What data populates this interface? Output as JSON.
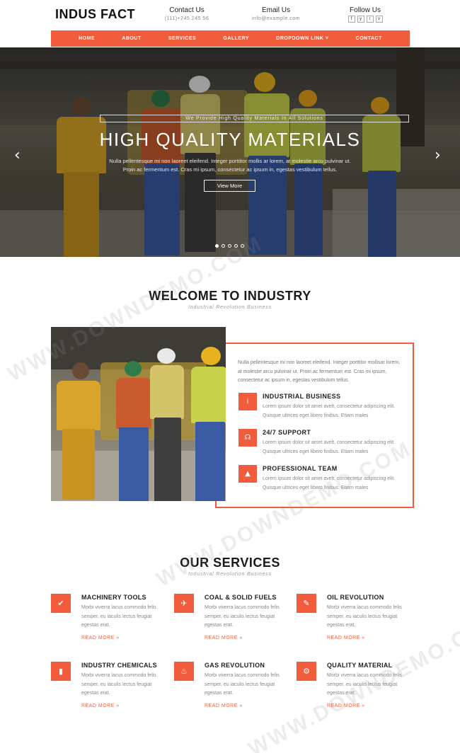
{
  "header": {
    "logo": "INDUS FACT",
    "contact": {
      "heading": "Contact Us",
      "value": "(111)+245 245 56"
    },
    "email": {
      "heading": "Email Us",
      "value": "info@example.com"
    },
    "follow": {
      "heading": "Follow Us",
      "icons": [
        "f",
        "y",
        "r",
        "v"
      ]
    }
  },
  "nav": {
    "items": [
      "HOME",
      "ABOUT",
      "SERVICES",
      "GALLERY",
      "DROPDOWN LINK ˅",
      "CONTACT"
    ]
  },
  "hero": {
    "tagline": "We Provide High Quality Materials In All Solutions",
    "title": "HIGH QUALITY MATERIALS",
    "text": "Nulla pellentesque mi non laoreet eleifend. Integer porttitor mollis ar lorem, at molestie arcu pulvinar ut. Proin ac fermentum est. Cras mi ipsum, consectetur ac ipsum in, egestas vestibulum tellus.",
    "button": "View More",
    "prev_icon": "‹",
    "next_icon": "›",
    "slide_count": 5,
    "active_slide": 0
  },
  "welcome": {
    "title": "WELCOME TO INDUSTRY",
    "subtitle": "Industrial Revolution Business",
    "intro": "Nulla pellentesque mi non laoreet eleifend. Integer porttitor mollisar lorem, at molestie arcu pulvinar ut. Proin ac fermentum est. Cras mi ipsum, consectetur ac ipsum in, egestas vestibulum tellus.",
    "features": [
      {
        "icon": "info-icon",
        "glyph": "i",
        "title": "INDUSTRIAL BUSINESS",
        "text": "Lorem ipsum dolor sit amet avelt, consectetur adipiscing elit. Quisque ultrices eget libero finibus. Etiam males"
      },
      {
        "icon": "headset-icon",
        "glyph": "☊",
        "title": "24/7 SUPPORT",
        "text": "Lorem ipsum dolor sit amet avelt, consectetur adipiscing elit. Quisque ultrices eget libero finibus. Etiam males"
      },
      {
        "icon": "team-icon",
        "glyph": "▲",
        "title": "PROFESSIONAL TEAM",
        "text": "Lorem ipsum dolor sit amet avelt, consectetur adipiscing elit. Quisque ultrices eget libero finibus. Etiam males"
      }
    ]
  },
  "services": {
    "title": "OUR SERVICES",
    "subtitle": "Industrial Revolution Business",
    "items": [
      {
        "icon": "tools-icon",
        "glyph": "✔",
        "title": "MACHINERY TOOLS",
        "text": "Morbi viverra lacus commodo felis semper, eu iaculis lectus feugiat egestas erat.",
        "more": "READ MORE »"
      },
      {
        "icon": "rocket-icon",
        "glyph": "✈",
        "title": "COAL & SOLID FUELS",
        "text": "Morbi viverra lacus commodo felis semper, eu iaculis lectus feugiat egestas erat.",
        "more": "READ MORE »"
      },
      {
        "icon": "brush-icon",
        "glyph": "✎",
        "title": "OIL REVOLUTION",
        "text": "Morbi viverra lacus commodo felis semper, eu iaculis lectus feugiat egestas erat.",
        "more": "READ MORE »"
      },
      {
        "icon": "factory-icon",
        "glyph": "▮",
        "title": "INDUSTRY CHEMICALS",
        "text": "Morbi viverra lacus commodo felis semper, eu iaculis lectus feugiat egestas erat.",
        "more": "READ MORE »"
      },
      {
        "icon": "fire-icon",
        "glyph": "♨",
        "title": "GAS REVOLUTION",
        "text": "Morbi viverra lacus commodo felis semper, eu iaculis lectus feugiat egestas erat.",
        "more": "READ MORE »"
      },
      {
        "icon": "gears-icon",
        "glyph": "⚙",
        "title": "QUALITY MATERIAL",
        "text": "Morbi viverra lacus commodo felis semper, eu iaculis lectus feugiat egestas erat.",
        "more": "READ MORE »"
      }
    ]
  },
  "watermark": "WWW.DOWNDEMO.COM",
  "colors": {
    "accent": "#f15d3c",
    "text": "#222222",
    "muted": "#888888"
  }
}
